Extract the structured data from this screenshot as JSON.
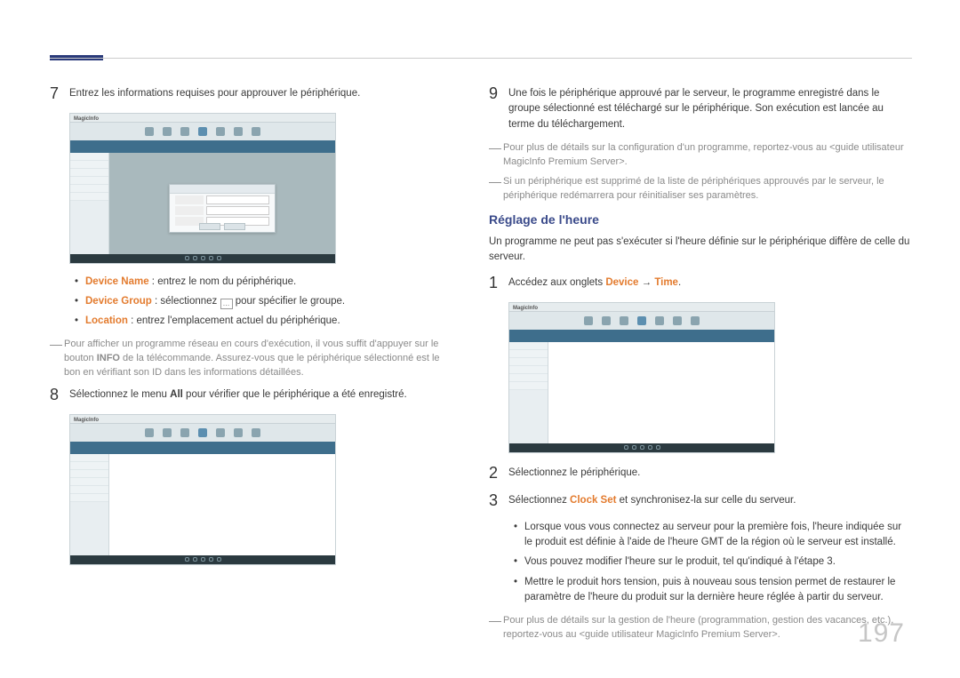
{
  "page_number": "197",
  "left": {
    "step7": {
      "num": "7",
      "text": "Entrez les informations requises pour approuver le périphérique."
    },
    "screenshot1_brand": "MagicInfo",
    "bullets": {
      "name_label": "Device Name",
      "name_text": " : entrez le nom du périphérique.",
      "group_label": "Device Group",
      "group_pre": " : sélectionnez ",
      "group_post": " pour spécifier le groupe.",
      "group_icon": "…",
      "loc_label": "Location",
      "loc_text": " : entrez l'emplacement actuel du périphérique."
    },
    "note1_dash": "―",
    "note1": "Pour afficher un programme réseau en cours d'exécution, il vous suffit d'appuyer sur le bouton INFO de la télécommande. Assurez-vous que le périphérique sélectionné est le bon en vérifiant son ID dans les informations détaillées.",
    "info_bold": "INFO",
    "step8": {
      "num": "8",
      "text_pre": "Sélectionnez le menu ",
      "text_bold": "All",
      "text_post": " pour vérifier que le périphérique a été enregistré."
    }
  },
  "right": {
    "step9": {
      "num": "9",
      "text": "Une fois le périphérique approuvé par le serveur, le programme enregistré dans le groupe sélectionné est téléchargé sur le périphérique. Son exécution est lancée au terme du téléchargement."
    },
    "note_r1_dash": "―",
    "note_r1": "Pour plus de détails sur la configuration d'un programme, reportez-vous au <guide utilisateur MagicInfo Premium Server>.",
    "note_r2_dash": "―",
    "note_r2": "Si un périphérique est supprimé de la liste de périphériques approuvés par le serveur, le périphérique redémarrera pour réinitialiser ses paramètres.",
    "subhead": "Réglage de l'heure",
    "subhead_intro": "Un programme ne peut pas s'exécuter si l'heure définie sur le périphérique diffère de celle du serveur.",
    "step1": {
      "num": "1",
      "pre": "Accédez aux onglets ",
      "device": "Device",
      "arrow": " → ",
      "time": "Time",
      "post": "."
    },
    "step2": {
      "num": "2",
      "text": "Sélectionnez le périphérique."
    },
    "step3": {
      "num": "3",
      "pre": "Sélectionnez ",
      "clockset": "Clock Set",
      "post": " et synchronisez-la sur celle du serveur."
    },
    "step3_bullets": {
      "b1": "Lorsque vous vous connectez au serveur pour la première fois, l'heure indiquée sur le produit est définie à l'aide de l'heure GMT de la région où le serveur est installé.",
      "b2": "Vous pouvez modifier l'heure sur le produit, tel qu'indiqué à l'étape 3.",
      "b3": "Mettre le produit hors tension, puis à nouveau sous tension permet de restaurer le paramètre de l'heure du produit sur la dernière heure réglée à partir du serveur."
    },
    "note_r3_dash": "―",
    "note_r3": "Pour plus de détails sur la gestion de l'heure (programmation, gestion des vacances, etc.), reportez-vous au <guide utilisateur MagicInfo Premium Server>."
  }
}
